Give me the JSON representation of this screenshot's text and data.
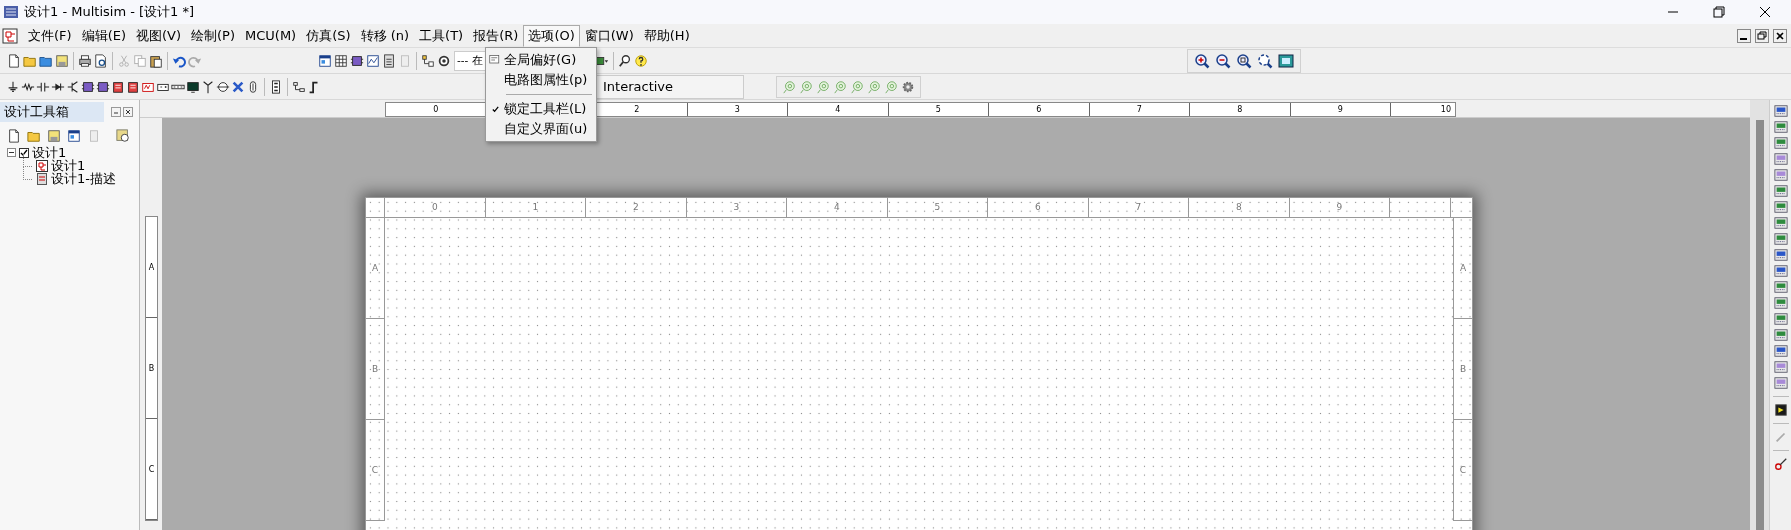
{
  "window": {
    "title": "设计1 - Multisim - [设计1 *]"
  },
  "menu_bar": [
    {
      "label": "文件(F)",
      "selected": false
    },
    {
      "label": "编辑(E)",
      "selected": false
    },
    {
      "label": "视图(V)",
      "selected": false
    },
    {
      "label": "绘制(P)",
      "selected": false
    },
    {
      "label": "MCU(M)",
      "selected": false
    },
    {
      "label": "仿真(S)",
      "selected": false
    },
    {
      "label": "转移 (n)",
      "selected": false
    },
    {
      "label": "工具(T)",
      "selected": false
    },
    {
      "label": "报告(R)",
      "selected": false
    },
    {
      "label": "选项(O)",
      "selected": true
    },
    {
      "label": "窗口(W)",
      "selected": false
    },
    {
      "label": "帮助(H)",
      "selected": false
    }
  ],
  "toolbar": {
    "component_list": {
      "value": "--- 在"
    },
    "simulation_mode": "Interactive"
  },
  "options_menu": {
    "items": [
      {
        "kind": "item",
        "label": "全局偏好(G)",
        "checked": false,
        "icon": true
      },
      {
        "kind": "item",
        "label": "电路图属性(p)",
        "checked": false,
        "icon": false
      },
      {
        "kind": "separator"
      },
      {
        "kind": "item",
        "label": "锁定工具栏(L)",
        "checked": true,
        "icon": false
      },
      {
        "kind": "item",
        "label": "自定义界面(u)",
        "checked": false,
        "icon": false
      }
    ]
  },
  "design_toolbox": {
    "title": "设计工具箱",
    "tree": [
      {
        "label": "设计1",
        "expanded": true,
        "checked": true,
        "children": [
          {
            "label": "设计1",
            "kind": "schematic"
          },
          {
            "label": "设计1-描述",
            "kind": "description"
          }
        ]
      }
    ]
  },
  "ruler": {
    "columns": [
      "0",
      "2",
      "3",
      "4",
      "5",
      "6",
      "7",
      "8",
      "9",
      "10"
    ],
    "rows": [
      "A",
      "B",
      "C"
    ]
  },
  "sheet": {
    "columns": [
      "0",
      "1",
      "2",
      "3",
      "4",
      "5",
      "6",
      "7",
      "8",
      "9"
    ],
    "rows_left": [
      "A",
      "B",
      "C"
    ],
    "rows_right": [
      "A",
      "B",
      "C"
    ]
  }
}
